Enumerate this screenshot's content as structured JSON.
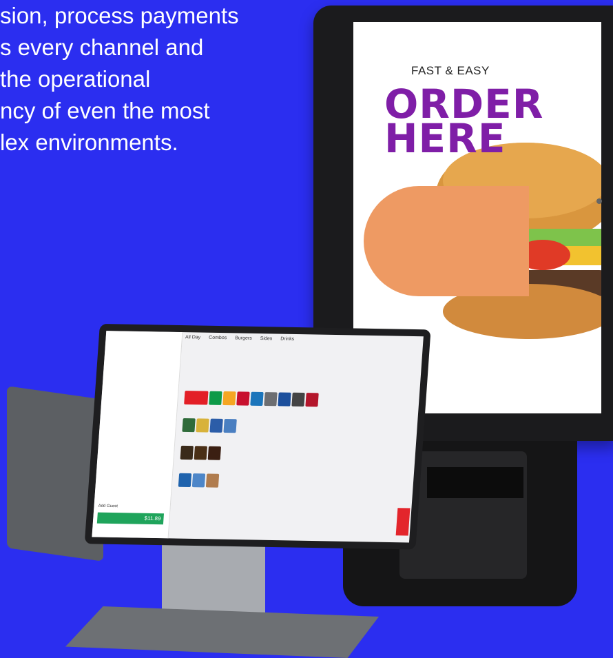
{
  "headline": {
    "lines": [
      "sion, process payments",
      "s every channel and",
      "the operational",
      "ncy of even the most",
      "lex environments."
    ]
  },
  "kiosk": {
    "tagline": "FAST & EASY",
    "title_line1": "ORDER",
    "title_line2": "HERE"
  },
  "pos": {
    "tabs": [
      "All Day",
      "Combos",
      "Burgers",
      "Sides",
      "Drinks"
    ],
    "total": "$11.89",
    "add_guest": "Add Guest",
    "colors": {
      "accent": "#1fa45b",
      "alert": "#e3252b"
    }
  }
}
